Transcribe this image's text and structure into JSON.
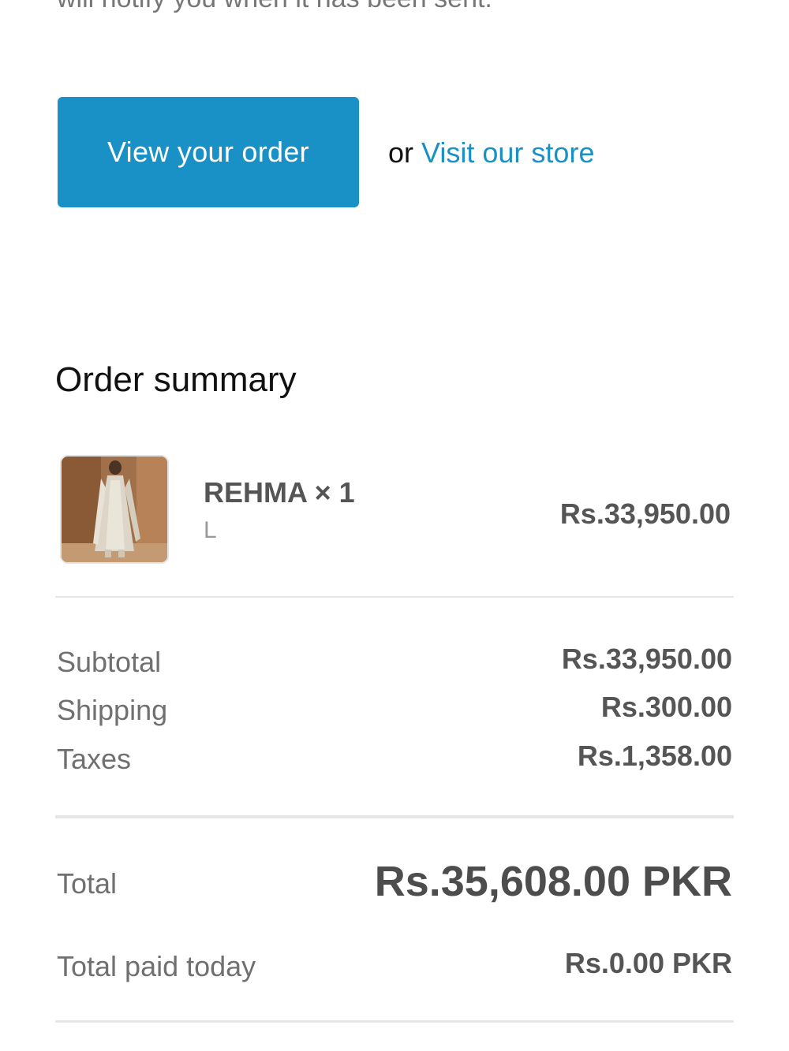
{
  "header": {
    "notify_text": "will notify you when it has been sent."
  },
  "actions": {
    "view_order_label": "View your order",
    "or_label": "or",
    "visit_store_label": "Visit our store"
  },
  "summary": {
    "title": "Order summary",
    "item": {
      "name": "REHMA × 1",
      "variant": "L",
      "price": "Rs.33,950.00",
      "thumbnail_icon": "product-dress-image"
    },
    "subtotal": {
      "label": "Subtotal",
      "value": "Rs.33,950.00"
    },
    "shipping": {
      "label": "Shipping",
      "value": "Rs.300.00"
    },
    "taxes": {
      "label": "Taxes",
      "value": "Rs.1,358.00"
    },
    "total": {
      "label": "Total",
      "value": "Rs.35,608.00 PKR"
    },
    "total_paid": {
      "label": "Total paid today",
      "value": "Rs.0.00 PKR"
    }
  },
  "colors": {
    "accent": "#1990c6",
    "text_dark": "#111111",
    "text_muted": "#707070",
    "divider": "#e6e6e6"
  }
}
